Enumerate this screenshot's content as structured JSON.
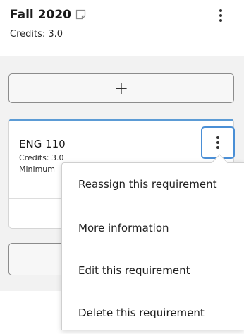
{
  "term": {
    "title": "Fall 2020",
    "credits": "Credits:  3.0",
    "note_icon": "note-icon",
    "menu_icon": "kebab-menu-icon"
  },
  "add_button": {
    "label": "+"
  },
  "requirement": {
    "title": "ENG 110",
    "credits": "Credits: 3.0",
    "minimum": "Minimum",
    "menu_icon": "kebab-menu-icon"
  },
  "dropdown": {
    "items": [
      {
        "label": "More information"
      },
      {
        "label": "Edit this requirement"
      },
      {
        "label": "Delete this requirement"
      },
      {
        "label": "Reassign this requirement"
      }
    ]
  },
  "colors": {
    "accent": "#4a8fd6",
    "panel_bg": "#f2f2f2"
  }
}
